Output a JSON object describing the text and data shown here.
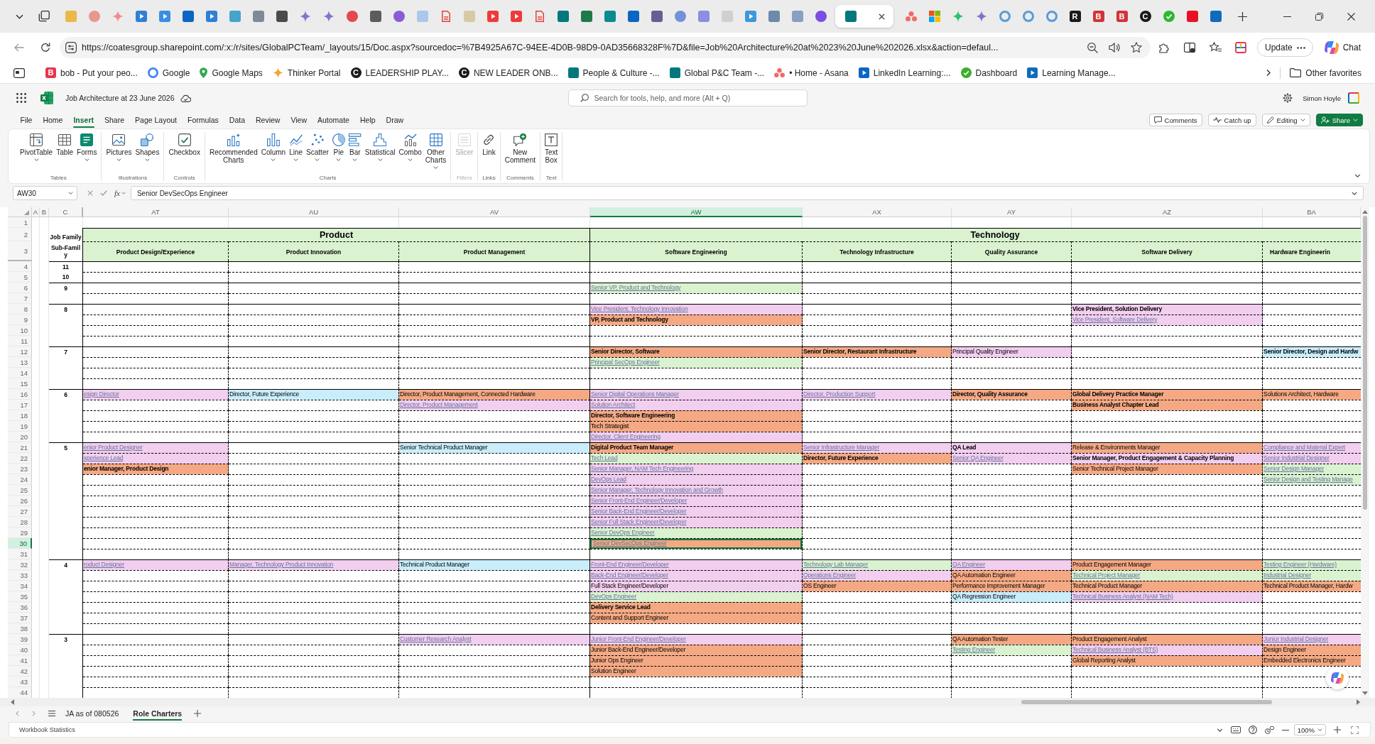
{
  "browser": {
    "tabs": [
      {
        "kind": "tile",
        "color": "#e9b949",
        "selected": false
      },
      {
        "kind": "circle",
        "color": "#e8978c",
        "selected": false
      },
      {
        "kind": "spark",
        "color": "#f08c8c",
        "selected": false
      },
      {
        "kind": "play",
        "color": "#2f7fd6",
        "selected": false
      },
      {
        "kind": "play",
        "color": "#3a8ee0",
        "selected": false
      },
      {
        "kind": "tile",
        "color": "#0a66c2",
        "selected": false
      },
      {
        "kind": "play",
        "color": "#2f7fd6",
        "selected": false
      },
      {
        "kind": "tile",
        "color": "#46a3c9",
        "selected": false
      },
      {
        "kind": "tile",
        "color": "#7d8b99",
        "selected": false
      },
      {
        "kind": "tile",
        "color": "#4a4a4a",
        "selected": false
      },
      {
        "kind": "spark",
        "color": "#8a6fd1",
        "selected": false
      },
      {
        "kind": "spark",
        "color": "#8a6fd1",
        "selected": false
      },
      {
        "kind": "circle",
        "color": "#e5484d",
        "selected": false
      },
      {
        "kind": "tile",
        "color": "#5c5c5c",
        "selected": false
      },
      {
        "kind": "circle",
        "color": "#8a5cd6",
        "selected": false
      },
      {
        "kind": "tile",
        "color": "#a9c8ea",
        "selected": false
      },
      {
        "kind": "doc",
        "color": "#e0443e",
        "selected": false
      },
      {
        "kind": "tile",
        "color": "#d8c9a6",
        "selected": false
      },
      {
        "kind": "play",
        "color": "#f03a3a",
        "selected": false
      },
      {
        "kind": "play",
        "color": "#f03a3a",
        "selected": false
      },
      {
        "kind": "doc",
        "color": "#e0443e",
        "selected": false
      },
      {
        "kind": "tile",
        "color": "#03787c",
        "selected": false
      },
      {
        "kind": "tile",
        "color": "#1f7a4a",
        "selected": false
      },
      {
        "kind": "tile",
        "color": "#0b8a8f",
        "selected": false
      },
      {
        "kind": "tile",
        "color": "#0a66c2",
        "selected": false
      },
      {
        "kind": "tile",
        "color": "#6b5b95",
        "selected": false
      },
      {
        "kind": "circle",
        "color": "#7391d9",
        "selected": false
      },
      {
        "kind": "tile",
        "color": "#8b8fe0",
        "selected": false
      },
      {
        "kind": "tile",
        "color": "#cfcfcf",
        "selected": false
      },
      {
        "kind": "play",
        "color": "#3b98db",
        "selected": false
      },
      {
        "kind": "tile",
        "color": "#6d8aa8",
        "selected": false
      },
      {
        "kind": "tile",
        "color": "#8a9fc2",
        "selected": false
      },
      {
        "kind": "circle",
        "color": "#7b4de0",
        "selected": false
      },
      {
        "kind": "tile",
        "color": "#03787c",
        "selected": true
      },
      {
        "kind": "dots",
        "color": "#f06a6a",
        "selected": false
      },
      {
        "kind": "grid",
        "selected": false
      },
      {
        "kind": "spark",
        "color": "#2fbf71",
        "selected": false
      },
      {
        "kind": "spark",
        "color": "#8a6fd1",
        "selected": false
      },
      {
        "kind": "ring",
        "color": "#5b9bd5",
        "selected": false
      },
      {
        "kind": "ring",
        "color": "#5b9bd5",
        "selected": false
      },
      {
        "kind": "ring",
        "color": "#5b9bd5",
        "selected": false
      },
      {
        "kind": "letter",
        "letter": "R",
        "color": "#1a1a1a",
        "selected": false
      },
      {
        "kind": "letter",
        "letter": "B",
        "color": "#d13438",
        "selected": false
      },
      {
        "kind": "letter",
        "letter": "B",
        "color": "#d13438",
        "selected": false
      },
      {
        "kind": "initial",
        "letter": "C",
        "color": "#1a1a1a",
        "selected": false
      },
      {
        "kind": "check",
        "color": "#2eb82e",
        "selected": false
      },
      {
        "kind": "tile",
        "color": "#e81123",
        "selected": false
      },
      {
        "kind": "tile",
        "color": "#0f6cbd",
        "selected": false
      }
    ],
    "url": "https://coatesgroup.sharepoint.com/:x:/r/sites/GlobalPCTeam/_layouts/15/Doc.aspx?sourcedoc=%7B4925A67C-94EE-4D0B-98D9-0AD35668328F%7D&file=Job%20Architecture%20at%2023%20June%202026.xlsx&action=defaul...",
    "update_label": "Update",
    "chat_label": "Chat",
    "bookmarks": [
      {
        "label": "bob - Put your peo...",
        "kind": "letter",
        "letter": "B",
        "color": "#e8344e"
      },
      {
        "label": "Google",
        "kind": "ring",
        "color": "#4285f4"
      },
      {
        "label": "Google Maps",
        "kind": "pin",
        "color": "#34a853"
      },
      {
        "label": "Thinker Portal",
        "kind": "spark",
        "color": "#f4a62a"
      },
      {
        "label": "LEADERSHIP PLAY...",
        "kind": "initial",
        "letter": "C",
        "color": "#1a1a1a"
      },
      {
        "label": "NEW LEADER ONB...",
        "kind": "initial",
        "letter": "C",
        "color": "#1a1a1a"
      },
      {
        "label": "People & Culture -...",
        "kind": "tile",
        "color": "#03787c"
      },
      {
        "label": "Global P&C Team -...",
        "kind": "tile",
        "color": "#03787c"
      },
      {
        "label": "• Home - Asana",
        "kind": "dots",
        "color": "#f06a6a"
      },
      {
        "label": "LinkedIn Learning:...",
        "kind": "play",
        "color": "#0a66c2"
      },
      {
        "label": "Dashboard",
        "kind": "check",
        "color": "#3dae2b"
      },
      {
        "label": "Learning Manage...",
        "kind": "play",
        "color": "#0f6cbd"
      }
    ],
    "other_favorites": "Other favorites"
  },
  "excel": {
    "title": "Job Architecture at 23 June 2026",
    "search_placeholder": "Search for tools, help, and more (Alt + Q)",
    "user": "Simon Hoyle",
    "menu": [
      {
        "label": "File",
        "selected": false
      },
      {
        "label": "Home",
        "selected": false
      },
      {
        "label": "Insert",
        "selected": true
      },
      {
        "label": "Share",
        "selected": false
      },
      {
        "label": "Page Layout",
        "selected": false
      },
      {
        "label": "Formulas",
        "selected": false
      },
      {
        "label": "Data",
        "selected": false
      },
      {
        "label": "Review",
        "selected": false
      },
      {
        "label": "View",
        "selected": false
      },
      {
        "label": "Automate",
        "selected": false
      },
      {
        "label": "Help",
        "selected": false
      },
      {
        "label": "Draw",
        "selected": false
      }
    ],
    "actions": [
      {
        "label": "Comments",
        "kind": "comments",
        "dropdown": false
      },
      {
        "label": "Catch up",
        "kind": "catchup",
        "dropdown": false
      },
      {
        "label": "Editing",
        "kind": "editing",
        "dropdown": true
      },
      {
        "label": "Share",
        "kind": "share",
        "dropdown": true
      }
    ],
    "ribbon": [
      {
        "label": "Tables",
        "disabled": false,
        "buttons": [
          {
            "label": "PivotTable",
            "kind": "pivot",
            "dropdown": true,
            "disabled": false
          },
          {
            "label": "Table",
            "kind": "table",
            "dropdown": false,
            "disabled": false
          },
          {
            "label": "Forms",
            "kind": "forms",
            "dropdown": true,
            "disabled": false
          }
        ]
      },
      {
        "label": "Illustrations",
        "disabled": false,
        "buttons": [
          {
            "label": "Pictures",
            "kind": "pictures",
            "dropdown": true,
            "disabled": false
          },
          {
            "label": "Shapes",
            "kind": "shapes",
            "dropdown": true,
            "disabled": false
          }
        ]
      },
      {
        "label": "Controls",
        "disabled": false,
        "buttons": [
          {
            "label": "Checkbox",
            "kind": "checkbox",
            "dropdown": false,
            "disabled": false
          }
        ]
      },
      {
        "label": "Charts",
        "disabled": false,
        "buttons": [
          {
            "label": "Recommended Charts",
            "kind": "recommended",
            "dropdown": false,
            "disabled": false
          },
          {
            "label": "Column",
            "kind": "column",
            "dropdown": true,
            "disabled": false
          },
          {
            "label": "Line",
            "kind": "line",
            "dropdown": true,
            "disabled": false
          },
          {
            "label": "Scatter",
            "kind": "scatter",
            "dropdown": true,
            "disabled": false
          },
          {
            "label": "Pie",
            "kind": "pie",
            "dropdown": true,
            "disabled": false
          },
          {
            "label": "Bar",
            "kind": "bar",
            "dropdown": true,
            "disabled": false
          },
          {
            "label": "Statistical",
            "kind": "statistical",
            "dropdown": true,
            "disabled": false
          },
          {
            "label": "Combo",
            "kind": "combo",
            "dropdown": true,
            "disabled": false
          },
          {
            "label": "Other Charts",
            "kind": "other",
            "dropdown": true,
            "disabled": false
          }
        ]
      },
      {
        "label": "Filters",
        "disabled": true,
        "buttons": [
          {
            "label": "Slicer",
            "kind": "slicer",
            "dropdown": false,
            "disabled": true
          }
        ]
      },
      {
        "label": "Links",
        "disabled": false,
        "buttons": [
          {
            "label": "Link",
            "kind": "link",
            "dropdown": false,
            "disabled": false
          }
        ]
      },
      {
        "label": "Comments",
        "disabled": false,
        "buttons": [
          {
            "label": "New Comment",
            "kind": "comment",
            "dropdown": false,
            "disabled": false
          }
        ]
      },
      {
        "label": "Text",
        "disabled": false,
        "buttons": [
          {
            "label": "Text Box",
            "kind": "textbox",
            "dropdown": false,
            "disabled": false
          }
        ]
      }
    ],
    "name_box": "AW30",
    "function_button": "fx",
    "formula": "Senior DevSecOps Engineer",
    "sheet": {
      "columns": [
        {
          "letter": "A",
          "selected": false
        },
        {
          "letter": "B",
          "selected": false
        },
        {
          "letter": "C",
          "selected": false
        },
        {
          "letter": "AT",
          "selected": false
        },
        {
          "letter": "AU",
          "selected": false
        },
        {
          "letter": "AV",
          "selected": false
        },
        {
          "letter": "AW",
          "selected": true
        },
        {
          "letter": "AX",
          "selected": false
        },
        {
          "letter": "AY",
          "selected": false
        },
        {
          "letter": "AZ",
          "selected": false
        },
        {
          "letter": "BA",
          "selected": false
        }
      ],
      "header_rows": [
        {
          "number": "1",
          "selected": false
        },
        {
          "number": "2",
          "selected": false
        },
        {
          "number": "3",
          "selected": false
        }
      ],
      "family_label": "Job Family",
      "subfamily_label": "Sub-Family",
      "families": [
        {
          "name": "Product",
          "subfamilies": [
            "Product Design/Experience",
            "Product Innovation",
            "Product Management"
          ]
        },
        {
          "name": "Technology",
          "subfamilies": [
            "Software Engineering",
            "Technology Infrastructure",
            "Quality Assurance",
            "Software Delivery",
            "Hardware Engineerin"
          ]
        }
      ],
      "bands": [
        {
          "rows": [
            {
              "number": "4",
              "selected": false,
              "level": "11"
            },
            {
              "number": "5",
              "selected": false,
              "level": "10"
            }
          ]
        },
        {
          "rows": [
            {
              "number": "6",
              "selected": false,
              "level": "9",
              "cells": [
                null,
                null,
                null,
                {
                  "text": "Senior VP, Product and Technology",
                  "kind": "link",
                  "color": "#daf2d0"
                }
              ]
            },
            {
              "number": "7",
              "selected": false
            }
          ]
        },
        {
          "rows": [
            {
              "number": "8",
              "selected": false,
              "level": "8",
              "cells": [
                null,
                null,
                null,
                {
                  "text": "Vice President, Technology Innovation",
                  "kind": "link",
                  "color": "#f2ceef"
                },
                null,
                null,
                {
                  "text": "Vice President, Solution Delivery",
                  "kind": "bold",
                  "color": "#f2ceef"
                }
              ]
            },
            {
              "number": "9",
              "selected": false,
              "cells": [
                null,
                null,
                null,
                {
                  "text": "VP, Product and Technology",
                  "kind": "bold",
                  "color": "#f4a984"
                },
                null,
                null,
                {
                  "text": "Vice President, Software Delivery",
                  "kind": "link",
                  "color": "#f2ceef"
                }
              ]
            },
            {
              "number": "10",
              "selected": false
            },
            {
              "number": "11",
              "selected": false
            }
          ]
        },
        {
          "rows": [
            {
              "number": "12",
              "selected": false,
              "level": "7",
              "cells": [
                null,
                null,
                null,
                {
                  "text": "Senior Director, Software",
                  "kind": "bold",
                  "color": "#f4a984"
                },
                {
                  "text": "Senior Director, Restaurant Infrastructure",
                  "kind": "bold",
                  "color": "#f4a984"
                },
                {
                  "text": "Principal Quality Engineer",
                  "kind": "plain",
                  "color": "#f2ceef"
                },
                null,
                {
                  "text": "Senior Director, Design and Hardw",
                  "kind": "bold",
                  "color": "#caedfb"
                }
              ]
            },
            {
              "number": "13",
              "selected": false,
              "cells": [
                null,
                null,
                null,
                {
                  "text": "Principal SecOps Engineer",
                  "kind": "link",
                  "color": "#daf2d0"
                }
              ]
            },
            {
              "number": "14",
              "selected": false
            },
            {
              "number": "15",
              "selected": false
            }
          ]
        },
        {
          "rows": [
            {
              "number": "16",
              "selected": false,
              "level": "6",
              "cells": [
                {
                  "text": "esign Director",
                  "kind": "link",
                  "color": "#f2ceef"
                },
                {
                  "text": "Director, Future Experience",
                  "kind": "plain",
                  "color": "#caedfb"
                },
                {
                  "text": "Director, Product Management, Connected Hardware",
                  "kind": "plain",
                  "color": "#f4a984"
                },
                {
                  "text": "Senior Digital Operations Manager",
                  "kind": "link",
                  "color": "#f2ceef"
                },
                {
                  "text": "Director, Production Support",
                  "kind": "link",
                  "color": "#f2ceef"
                },
                {
                  "text": "Director, Quality Assurance",
                  "kind": "bold",
                  "color": "#f4a984"
                },
                {
                  "text": "Global Delivery Practice Manager",
                  "kind": "bold",
                  "color": "#f4a984"
                },
                {
                  "text": "Solutions Architect, Hardware",
                  "kind": "plain",
                  "color": "#f4a984"
                }
              ]
            },
            {
              "number": "17",
              "selected": false,
              "cells": [
                null,
                null,
                {
                  "text": "Director, Product Management",
                  "kind": "link",
                  "color": "#f2ceef"
                },
                {
                  "text": "Solution Architect",
                  "kind": "link",
                  "color": "#f2ceef"
                },
                null,
                null,
                {
                  "text": "Business Analyst Chapter Lead",
                  "kind": "bold",
                  "color": "#f4a984"
                }
              ]
            },
            {
              "number": "18",
              "selected": false,
              "cells": [
                null,
                null,
                null,
                {
                  "text": "Director, Software Engineering",
                  "kind": "bold",
                  "color": "#f4a984"
                }
              ]
            },
            {
              "number": "19",
              "selected": false,
              "cells": [
                null,
                null,
                null,
                {
                  "text": "Tech Strategist",
                  "kind": "plain",
                  "color": "#f4a984"
                }
              ]
            },
            {
              "number": "20",
              "selected": false,
              "cells": [
                null,
                null,
                null,
                {
                  "text": "Director, Client Engineering",
                  "kind": "link",
                  "color": "#f2ceef"
                }
              ]
            }
          ]
        },
        {
          "rows": [
            {
              "number": "21",
              "selected": false,
              "level": "5",
              "cells": [
                {
                  "text": "enior Product Designer",
                  "kind": "link",
                  "color": "#f2ceef"
                },
                null,
                {
                  "text": "Senior Technical Product Manager",
                  "kind": "plain",
                  "color": "#caedfb"
                },
                {
                  "text": "Digital Product Team Manager",
                  "kind": "bold",
                  "color": "#f4a984"
                },
                {
                  "text": "Senior Infrastructure Manager",
                  "kind": "link",
                  "color": "#f2ceef"
                },
                {
                  "text": "QA Lead",
                  "kind": "bold",
                  "color": "#f2ceef"
                },
                {
                  "text": "Release & Environments Manager",
                  "kind": "plain",
                  "color": "#f4a984"
                },
                {
                  "text": "Compliance and Material Expert",
                  "kind": "link",
                  "color": "#f2ceef"
                }
              ]
            },
            {
              "number": "22",
              "selected": false,
              "cells": [
                {
                  "text": "xperience Lead",
                  "kind": "link",
                  "color": "#f2ceef"
                },
                null,
                null,
                {
                  "text": "Tech Lead",
                  "kind": "link",
                  "color": "#daf2d0"
                },
                {
                  "text": "Director, Future Experience",
                  "kind": "bold",
                  "color": "#f4a984"
                },
                {
                  "text": "Senior QA Engineer",
                  "kind": "link",
                  "color": "#f2ceef"
                },
                {
                  "text": "Senior Manager, Product Engagement & Capacity Planning",
                  "kind": "bold",
                  "color": "#f2ceef"
                },
                {
                  "text": "Senior Industrial Designer",
                  "kind": "link",
                  "color": "#f2ceef"
                }
              ]
            },
            {
              "number": "23",
              "selected": false,
              "cells": [
                {
                  "text": "enior Manager, Product Design",
                  "kind": "bold",
                  "color": "#f4a984"
                },
                null,
                null,
                {
                  "text": "Senior Manager, NAM Tech Engineering",
                  "kind": "link",
                  "color": "#f2ceef"
                },
                null,
                null,
                {
                  "text": "Senior Technical Project Manager",
                  "kind": "plain",
                  "color": "#f4a984"
                },
                {
                  "text": "Senior Design Manager",
                  "kind": "link",
                  "color": "#daf2d0"
                }
              ]
            },
            {
              "number": "24",
              "selected": false,
              "cells": [
                null,
                null,
                null,
                {
                  "text": "DevOps Lead",
                  "kind": "link",
                  "color": "#f2ceef"
                },
                null,
                null,
                null,
                {
                  "text": "Senior Design and Testing Manage",
                  "kind": "link",
                  "color": "#daf2d0"
                }
              ]
            },
            {
              "number": "25",
              "selected": false,
              "cells": [
                null,
                null,
                null,
                {
                  "text": "Senior Manager, Technology Innovation and Growth",
                  "kind": "link",
                  "color": "#f2ceef"
                }
              ]
            },
            {
              "number": "26",
              "selected": false,
              "cells": [
                null,
                null,
                null,
                {
                  "text": "Senior Front-End Engineer/Developer",
                  "kind": "link",
                  "color": "#f2ceef"
                }
              ]
            },
            {
              "number": "27",
              "selected": false,
              "cells": [
                null,
                null,
                null,
                {
                  "text": "Senior Back-End Engineer/Developer",
                  "kind": "link",
                  "color": "#f2ceef"
                }
              ]
            },
            {
              "number": "28",
              "selected": false,
              "cells": [
                null,
                null,
                null,
                {
                  "text": "Senior Full Stack Engineer/Developer",
                  "kind": "link",
                  "color": "#f2ceef"
                }
              ]
            },
            {
              "number": "29",
              "selected": false,
              "cells": [
                null,
                null,
                null,
                {
                  "text": "Senior DevOps Engineer",
                  "kind": "link",
                  "color": "#daf2d0"
                }
              ]
            },
            {
              "number": "30",
              "selected": true,
              "cells": [
                null,
                null,
                null,
                {
                  "text": "Senior DevSecOps Engineer",
                  "kind": "link",
                  "color": "#f4a984"
                }
              ]
            },
            {
              "number": "31",
              "selected": false
            }
          ]
        },
        {
          "rows": [
            {
              "number": "32",
              "selected": false,
              "level": "4",
              "cells": [
                {
                  "text": "roduct Designer",
                  "kind": "link",
                  "color": "#f2ceef"
                },
                {
                  "text": "Manager, Technology Product Innovation",
                  "kind": "link",
                  "color": "#f2ceef"
                },
                {
                  "text": "Technical Product Manager",
                  "kind": "plain",
                  "color": "#caedfb"
                },
                {
                  "text": "Front-End Engineer/Developer",
                  "kind": "link",
                  "color": "#f2ceef"
                },
                {
                  "text": "Technology Lab Manager",
                  "kind": "link",
                  "color": "#daf2d0"
                },
                {
                  "text": "QA Engineer",
                  "kind": "link",
                  "color": "#f2ceef"
                },
                {
                  "text": "Product Engagement Manager",
                  "kind": "plain",
                  "color": "#f4a984"
                },
                {
                  "text": "Testing Engineer (Hardware)",
                  "kind": "link",
                  "color": "#daf2d0"
                }
              ]
            },
            {
              "number": "33",
              "selected": false,
              "cells": [
                null,
                null,
                null,
                {
                  "text": "Back-End Engineer/Developer",
                  "kind": "link",
                  "color": "#f2ceef"
                },
                {
                  "text": "Operations Engineer",
                  "kind": "link",
                  "color": "#f2ceef"
                },
                {
                  "text": "QA Automation Engineer",
                  "kind": "plain",
                  "color": "#f4a984"
                },
                {
                  "text": "Technical Project Manager",
                  "kind": "link",
                  "color": "#daf2d0"
                },
                {
                  "text": "Industrial Designer",
                  "kind": "link",
                  "color": "#daf2d0"
                }
              ]
            },
            {
              "number": "34",
              "selected": false,
              "cells": [
                null,
                null,
                null,
                {
                  "text": "Full Stack Engineer/Developer",
                  "kind": "plain",
                  "color": "#f2ceef"
                },
                {
                  "text": "OS Engineer",
                  "kind": "plain",
                  "color": "#f4a984"
                },
                {
                  "text": "Performance Improvement Manager",
                  "kind": "plain",
                  "color": "#f4a984"
                },
                {
                  "text": "Technical Product Manager",
                  "kind": "plain",
                  "color": "#f4a984"
                },
                {
                  "text": "Technical Product Manager, Hardw",
                  "kind": "plain",
                  "color": "#f4a984"
                }
              ]
            },
            {
              "number": "35",
              "selected": false,
              "cells": [
                null,
                null,
                null,
                {
                  "text": "DevOps Engineer",
                  "kind": "link",
                  "color": "#daf2d0"
                },
                null,
                {
                  "text": "QA Regression Engineer",
                  "kind": "plain",
                  "color": "#caedfb"
                },
                {
                  "text": "Technical Business Analyst (NAM Tech)",
                  "kind": "link",
                  "color": "#f2ceef"
                }
              ]
            },
            {
              "number": "36",
              "selected": false,
              "cells": [
                null,
                null,
                null,
                {
                  "text": "Delivery Service Lead",
                  "kind": "bold",
                  "color": "#f4a984"
                }
              ]
            },
            {
              "number": "37",
              "selected": false,
              "cells": [
                null,
                null,
                null,
                {
                  "text": "Content and Support Engineer",
                  "kind": "plain",
                  "color": "#f4a984"
                }
              ]
            },
            {
              "number": "38",
              "selected": false
            }
          ]
        },
        {
          "rows": [
            {
              "number": "39",
              "selected": false,
              "level": "3",
              "cells": [
                null,
                null,
                {
                  "text": "Customer Research Analyst",
                  "kind": "link",
                  "color": "#f2ceef"
                },
                {
                  "text": "Junior Front-End Engineer/Developer",
                  "kind": "link",
                  "color": "#f2ceef"
                },
                null,
                {
                  "text": "QA Automation Tester",
                  "kind": "plain",
                  "color": "#f4a984"
                },
                {
                  "text": "Product Engagement Analyst",
                  "kind": "plain",
                  "color": "#f4a984"
                },
                {
                  "text": "Junior Industrial Designer",
                  "kind": "link",
                  "color": "#f2ceef"
                }
              ]
            },
            {
              "number": "40",
              "selected": false,
              "cells": [
                null,
                null,
                null,
                {
                  "text": "Junior Back-End Engineer/Developer",
                  "kind": "plain",
                  "color": "#f4a984"
                },
                null,
                {
                  "text": "Testing Engineer",
                  "kind": "link",
                  "color": "#daf2d0"
                },
                {
                  "text": "Technical Business Analyst (BTS)",
                  "kind": "link",
                  "color": "#f2ceef"
                },
                {
                  "text": "Design Engineer",
                  "kind": "plain",
                  "color": "#f4a984"
                }
              ]
            },
            {
              "number": "41",
              "selected": false,
              "cells": [
                null,
                null,
                null,
                {
                  "text": "Junior Ops Engineer",
                  "kind": "plain",
                  "color": "#f4a984"
                },
                null,
                null,
                {
                  "text": "Global Reporting Analyst",
                  "kind": "plain",
                  "color": "#f4a984"
                },
                {
                  "text": "Embedded Electronics Engineer",
                  "kind": "plain",
                  "color": "#f4a984"
                }
              ]
            },
            {
              "number": "42",
              "selected": false,
              "cells": [
                null,
                null,
                null,
                {
                  "text": "Solution Engineer",
                  "kind": "plain",
                  "color": "#f4a984"
                }
              ]
            },
            {
              "number": "43",
              "selected": false
            },
            {
              "number": "44",
              "selected": false
            }
          ]
        }
      ]
    },
    "sheet_tabs": [
      {
        "label": "JA as of 080526",
        "selected": false
      },
      {
        "label": "Role Charters",
        "selected": true
      }
    ],
    "status": "Workbook Statistics",
    "zoom": "100%"
  }
}
